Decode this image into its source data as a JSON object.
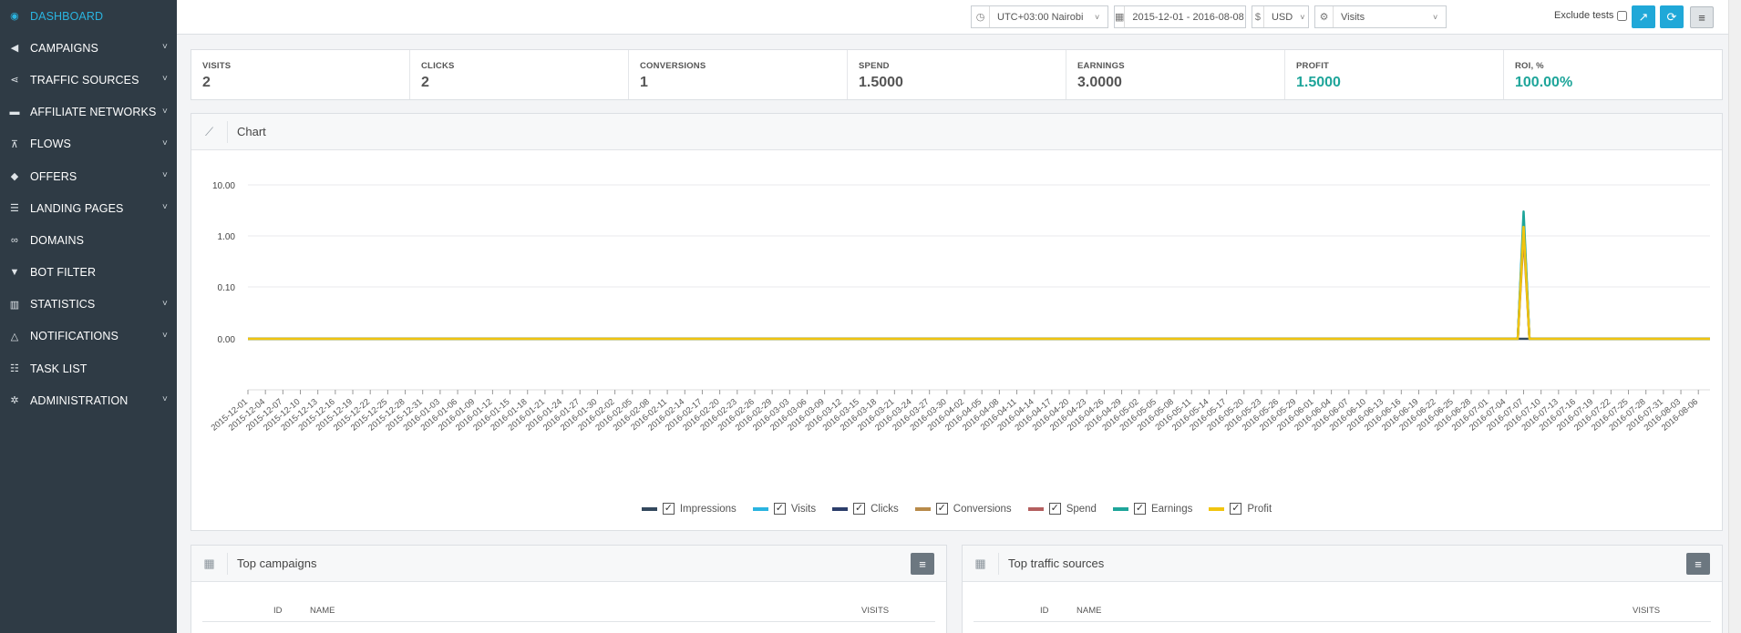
{
  "sidebar": {
    "items": [
      {
        "label": "DASHBOARD",
        "icon": "palette-icon",
        "glyph": "◉",
        "active": true,
        "chevron": false
      },
      {
        "label": "CAMPAIGNS",
        "icon": "megaphone-icon",
        "glyph": "◀",
        "active": false,
        "chevron": true
      },
      {
        "label": "TRAFFIC SOURCES",
        "icon": "share-icon",
        "glyph": "⋖",
        "active": false,
        "chevron": true
      },
      {
        "label": "AFFILIATE NETWORKS",
        "icon": "briefcase-icon",
        "glyph": "▬",
        "active": false,
        "chevron": true
      },
      {
        "label": "FLOWS",
        "icon": "sitemap-icon",
        "glyph": "⊼",
        "active": false,
        "chevron": true
      },
      {
        "label": "OFFERS",
        "icon": "tags-icon",
        "glyph": "◆",
        "active": false,
        "chevron": true
      },
      {
        "label": "LANDING PAGES",
        "icon": "list-icon",
        "glyph": "☰",
        "active": false,
        "chevron": true
      },
      {
        "label": "DOMAINS",
        "icon": "link-icon",
        "glyph": "∞",
        "active": false,
        "chevron": false
      },
      {
        "label": "BOT FILTER",
        "icon": "filter-icon",
        "glyph": "▼",
        "active": false,
        "chevron": false
      },
      {
        "label": "STATISTICS",
        "icon": "bar-chart-icon",
        "glyph": "▥",
        "active": false,
        "chevron": true
      },
      {
        "label": "NOTIFICATIONS",
        "icon": "bell-icon",
        "glyph": "△",
        "active": false,
        "chevron": true
      },
      {
        "label": "TASK LIST",
        "icon": "tasks-icon",
        "glyph": "☷",
        "active": false,
        "chevron": false
      },
      {
        "label": "ADMINISTRATION",
        "icon": "gear-icon",
        "glyph": "✲",
        "active": false,
        "chevron": true
      }
    ],
    "chevron_glyph": "˅"
  },
  "topbar": {
    "timezone": {
      "icon": "clock-icon",
      "value": "UTC+03:00 Nairobi"
    },
    "daterange": {
      "icon": "calendar-icon",
      "value": "2015-12-01 - 2016-08-08"
    },
    "currency": {
      "icon": "dollar-icon",
      "symbol": "$",
      "value": "USD"
    },
    "metric": {
      "icon": "gears-icon",
      "value": "Visits"
    },
    "exclude_label": "Exclude tests"
  },
  "stats": [
    {
      "label": "VISITS",
      "value": "2",
      "teal": false
    },
    {
      "label": "CLICKS",
      "value": "2",
      "teal": false
    },
    {
      "label": "CONVERSIONS",
      "value": "1",
      "teal": false
    },
    {
      "label": "SPEND",
      "value": "1.5000",
      "teal": false
    },
    {
      "label": "EARNINGS",
      "value": "3.0000",
      "teal": false
    },
    {
      "label": "PROFIT",
      "value": "1.5000",
      "teal": true
    },
    {
      "label": "ROI, %",
      "value": "100.00%",
      "teal": true
    }
  ],
  "chart_panel": {
    "title": "Chart",
    "icon": "line-chart-icon"
  },
  "chart_data": {
    "type": "line",
    "y_scale": "log",
    "y_ticks": [
      "10.00",
      "1.00",
      "0.10",
      "0.00"
    ],
    "x_start": "2015-12-01",
    "x_end": "2016-08-08",
    "x_tick_step_days": 3,
    "grid": true,
    "legend_position": "bottom",
    "spike_date": "2016-07-07",
    "series": [
      {
        "name": "Impressions",
        "color": "#34495e",
        "values_nonzero": {}
      },
      {
        "name": "Visits",
        "color": "#2ab4e0",
        "values_nonzero": {
          "2016-07-07": 2
        }
      },
      {
        "name": "Clicks",
        "color": "#2c3e6b",
        "values_nonzero": {
          "2016-07-07": 2
        }
      },
      {
        "name": "Conversions",
        "color": "#b88a4a",
        "values_nonzero": {
          "2016-07-07": 1
        }
      },
      {
        "name": "Spend",
        "color": "#b45f5f",
        "values_nonzero": {
          "2016-07-07": 1.5
        }
      },
      {
        "name": "Earnings",
        "color": "#1ea59a",
        "values_nonzero": {
          "2016-07-07": 3
        }
      },
      {
        "name": "Profit",
        "color": "#f1c40f",
        "values_nonzero": {
          "2016-07-07": 1.5
        }
      }
    ]
  },
  "top_campaigns": {
    "title": "Top campaigns",
    "icon": "table-icon",
    "columns": [
      "ID",
      "NAME",
      "VISITS"
    ]
  },
  "top_traffic": {
    "title": "Top traffic sources",
    "icon": "table-icon",
    "columns": [
      "ID",
      "NAME",
      "VISITS"
    ]
  },
  "glyphs": {
    "clock": "◷",
    "calendar": "▦",
    "gears": "⚙",
    "chart_btn": "↗",
    "refresh": "⟳",
    "menu": "≡",
    "dd": "˅",
    "table": "▦",
    "linechart": "⟋",
    "check": "✓"
  }
}
